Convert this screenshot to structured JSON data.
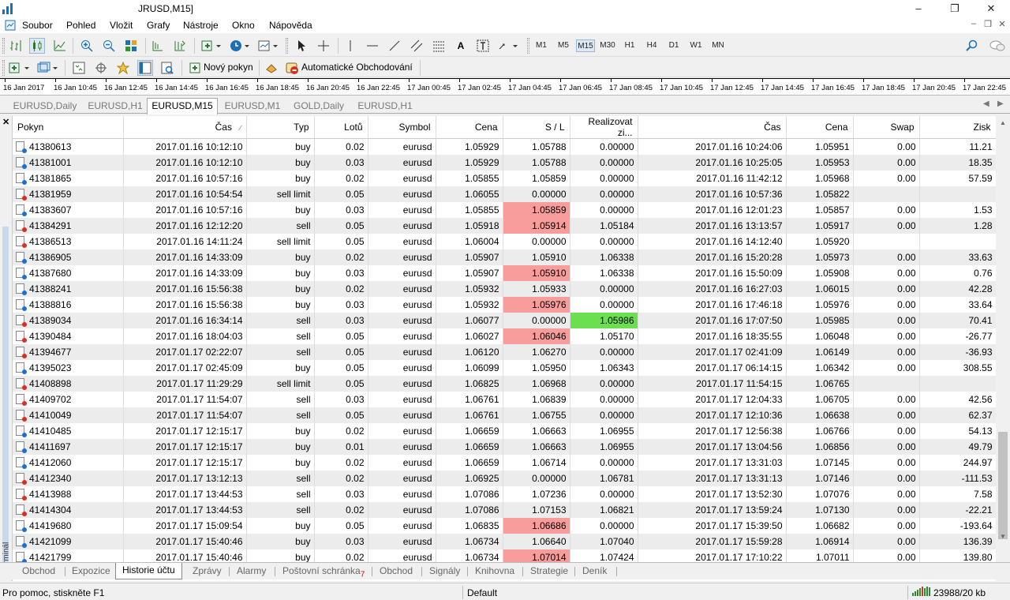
{
  "window": {
    "title": "JRUSD,M15]"
  },
  "menu": [
    "Soubor",
    "Pohled",
    "Vložit",
    "Grafy",
    "Nástroje",
    "Okno",
    "Nápověda"
  ],
  "toolbar": {
    "timeframes": [
      "M1",
      "M5",
      "M15",
      "M30",
      "H1",
      "H4",
      "D1",
      "W1",
      "MN"
    ],
    "active_timeframe": "M15",
    "new_order": "Nový pokyn",
    "auto_trading": "Automatické Obchodování"
  },
  "time_axis": [
    "16 Jan 2017",
    "16 Jan 10:45",
    "16 Jan 12:45",
    "16 Jan 14:45",
    "16 Jan 16:45",
    "16 Jan 18:45",
    "16 Jan 20:45",
    "16 Jan 22:45",
    "17 Jan 00:45",
    "17 Jan 02:45",
    "17 Jan 04:45",
    "17 Jan 06:45",
    "17 Jan 08:45",
    "17 Jan 10:45",
    "17 Jan 12:45",
    "17 Jan 14:45",
    "17 Jan 16:45",
    "17 Jan 18:45",
    "17 Jan 20:45",
    "17 Jan 22:45"
  ],
  "chart_tabs": [
    "EURUSD,Daily",
    "EURUSD,H1",
    "EURUSD,M15",
    "EURUSD,M1",
    "GOLD,Daily",
    "EURUSD,H1"
  ],
  "active_chart_tab": "EURUSD,M15",
  "terminal_label": "Terminál",
  "columns": [
    "Pokyn",
    "Čas",
    "Typ",
    "Lotů",
    "Symbol",
    "Cena",
    "S / L",
    "Realizovat zi...",
    "Čas",
    "Cena",
    "Swap",
    "Zisk"
  ],
  "rows": [
    {
      "id": "41380613",
      "open": "2017.01.16 10:12:10",
      "type": "buy",
      "lots": "0.02",
      "symbol": "eurusd",
      "price": "1.05929",
      "sl": "1.05788",
      "tp": "0.00000",
      "close": "2017.01.16 10:24:06",
      "cprice": "1.05951",
      "swap": "0.00",
      "profit": "11.21"
    },
    {
      "id": "41381001",
      "open": "2017.01.16 10:12:10",
      "type": "buy",
      "lots": "0.03",
      "symbol": "eurusd",
      "price": "1.05929",
      "sl": "1.05788",
      "tp": "0.00000",
      "close": "2017.01.16 10:25:05",
      "cprice": "1.05953",
      "swap": "0.00",
      "profit": "18.35"
    },
    {
      "id": "41381865",
      "open": "2017.01.16 10:57:16",
      "type": "buy",
      "lots": "0.02",
      "symbol": "eurusd",
      "price": "1.05855",
      "sl": "1.05859",
      "tp": "0.00000",
      "close": "2017.01.16 11:42:12",
      "cprice": "1.05968",
      "swap": "0.00",
      "profit": "57.59"
    },
    {
      "id": "41381959",
      "open": "2017.01.16 10:54:54",
      "type": "sell limit",
      "lots": "0.05",
      "symbol": "eurusd",
      "price": "1.06055",
      "sl": "0.00000",
      "tp": "0.00000",
      "close": "2017.01.16 10:57:36",
      "cprice": "1.05822",
      "swap": "",
      "profit": ""
    },
    {
      "id": "41383607",
      "open": "2017.01.16 10:57:16",
      "type": "buy",
      "lots": "0.03",
      "symbol": "eurusd",
      "price": "1.05855",
      "sl": "1.05859",
      "tp": "0.00000",
      "close": "2017.01.16 12:01:23",
      "cprice": "1.05857",
      "swap": "0.00",
      "profit": "1.53",
      "sl_hit": true
    },
    {
      "id": "41384291",
      "open": "2017.01.16 12:12:20",
      "type": "sell",
      "lots": "0.05",
      "symbol": "eurusd",
      "price": "1.05918",
      "sl": "1.05914",
      "tp": "1.05184",
      "close": "2017.01.16 13:13:57",
      "cprice": "1.05917",
      "swap": "0.00",
      "profit": "1.28",
      "sl_hit": true
    },
    {
      "id": "41386513",
      "open": "2017.01.16 14:11:24",
      "type": "sell limit",
      "lots": "0.05",
      "symbol": "eurusd",
      "price": "1.06004",
      "sl": "0.00000",
      "tp": "0.00000",
      "close": "2017.01.16 14:12:40",
      "cprice": "1.05920",
      "swap": "",
      "profit": ""
    },
    {
      "id": "41386905",
      "open": "2017.01.16 14:33:09",
      "type": "buy",
      "lots": "0.02",
      "symbol": "eurusd",
      "price": "1.05907",
      "sl": "1.05910",
      "tp": "1.06338",
      "close": "2017.01.16 15:20:28",
      "cprice": "1.05973",
      "swap": "0.00",
      "profit": "33.63"
    },
    {
      "id": "41387680",
      "open": "2017.01.16 14:33:09",
      "type": "buy",
      "lots": "0.03",
      "symbol": "eurusd",
      "price": "1.05907",
      "sl": "1.05910",
      "tp": "1.06338",
      "close": "2017.01.16 15:50:09",
      "cprice": "1.05908",
      "swap": "0.00",
      "profit": "0.76",
      "sl_hit": true
    },
    {
      "id": "41388241",
      "open": "2017.01.16 15:56:38",
      "type": "buy",
      "lots": "0.02",
      "symbol": "eurusd",
      "price": "1.05932",
      "sl": "1.05933",
      "tp": "0.00000",
      "close": "2017.01.16 16:27:03",
      "cprice": "1.06015",
      "swap": "0.00",
      "profit": "42.28"
    },
    {
      "id": "41388816",
      "open": "2017.01.16 15:56:38",
      "type": "buy",
      "lots": "0.03",
      "symbol": "eurusd",
      "price": "1.05932",
      "sl": "1.05976",
      "tp": "0.00000",
      "close": "2017.01.16 17:46:18",
      "cprice": "1.05976",
      "swap": "0.00",
      "profit": "33.64",
      "sl_hit": true
    },
    {
      "id": "41389034",
      "open": "2017.01.16 16:34:14",
      "type": "sell",
      "lots": "0.03",
      "symbol": "eurusd",
      "price": "1.06077",
      "sl": "0.00000",
      "tp": "1.05986",
      "close": "2017.01.16 17:07:50",
      "cprice": "1.05985",
      "swap": "0.00",
      "profit": "70.41",
      "tp_hit": true
    },
    {
      "id": "41390484",
      "open": "2017.01.16 18:04:03",
      "type": "sell",
      "lots": "0.05",
      "symbol": "eurusd",
      "price": "1.06027",
      "sl": "1.06046",
      "tp": "1.05170",
      "close": "2017.01.16 18:35:55",
      "cprice": "1.06048",
      "swap": "0.00",
      "profit": "-26.77",
      "sl_hit": true
    },
    {
      "id": "41394677",
      "open": "2017.01.17 02:22:07",
      "type": "sell",
      "lots": "0.05",
      "symbol": "eurusd",
      "price": "1.06120",
      "sl": "1.06270",
      "tp": "0.00000",
      "close": "2017.01.17 02:41:09",
      "cprice": "1.06149",
      "swap": "0.00",
      "profit": "-36.93"
    },
    {
      "id": "41395023",
      "open": "2017.01.17 02:45:09",
      "type": "buy",
      "lots": "0.05",
      "symbol": "eurusd",
      "price": "1.06099",
      "sl": "1.05950",
      "tp": "1.06343",
      "close": "2017.01.17 06:14:15",
      "cprice": "1.06342",
      "swap": "0.00",
      "profit": "308.55"
    },
    {
      "id": "41408898",
      "open": "2017.01.17 11:29:29",
      "type": "sell limit",
      "lots": "0.05",
      "symbol": "eurusd",
      "price": "1.06825",
      "sl": "1.06968",
      "tp": "0.00000",
      "close": "2017.01.17 11:54:15",
      "cprice": "1.06765",
      "swap": "",
      "profit": ""
    },
    {
      "id": "41409702",
      "open": "2017.01.17 11:54:07",
      "type": "sell",
      "lots": "0.03",
      "symbol": "eurusd",
      "price": "1.06761",
      "sl": "1.06839",
      "tp": "0.00000",
      "close": "2017.01.17 12:04:33",
      "cprice": "1.06705",
      "swap": "0.00",
      "profit": "42.56"
    },
    {
      "id": "41410049",
      "open": "2017.01.17 11:54:07",
      "type": "sell",
      "lots": "0.05",
      "symbol": "eurusd",
      "price": "1.06761",
      "sl": "1.06755",
      "tp": "0.00000",
      "close": "2017.01.17 12:10:36",
      "cprice": "1.06638",
      "swap": "0.00",
      "profit": "62.37"
    },
    {
      "id": "41410485",
      "open": "2017.01.17 12:15:17",
      "type": "buy",
      "lots": "0.02",
      "symbol": "eurusd",
      "price": "1.06659",
      "sl": "1.06663",
      "tp": "1.06955",
      "close": "2017.01.17 12:56:38",
      "cprice": "1.06766",
      "swap": "0.00",
      "profit": "54.13"
    },
    {
      "id": "41411697",
      "open": "2017.01.17 12:15:17",
      "type": "buy",
      "lots": "0.01",
      "symbol": "eurusd",
      "price": "1.06659",
      "sl": "1.06663",
      "tp": "1.06955",
      "close": "2017.01.17 13:04:56",
      "cprice": "1.06856",
      "swap": "0.00",
      "profit": "49.79"
    },
    {
      "id": "41412060",
      "open": "2017.01.17 12:15:17",
      "type": "buy",
      "lots": "0.02",
      "symbol": "eurusd",
      "price": "1.06659",
      "sl": "1.06714",
      "tp": "0.00000",
      "close": "2017.01.17 13:31:03",
      "cprice": "1.07145",
      "swap": "0.00",
      "profit": "244.97"
    },
    {
      "id": "41412340",
      "open": "2017.01.17 13:12:13",
      "type": "sell",
      "lots": "0.02",
      "symbol": "eurusd",
      "price": "1.06925",
      "sl": "0.00000",
      "tp": "1.06781",
      "close": "2017.01.17 13:31:13",
      "cprice": "1.07146",
      "swap": "0.00",
      "profit": "-111.53"
    },
    {
      "id": "41413988",
      "open": "2017.01.17 13:44:53",
      "type": "sell",
      "lots": "0.03",
      "symbol": "eurusd",
      "price": "1.07086",
      "sl": "1.07236",
      "tp": "0.00000",
      "close": "2017.01.17 13:52:30",
      "cprice": "1.07076",
      "swap": "0.00",
      "profit": "7.58"
    },
    {
      "id": "41414304",
      "open": "2017.01.17 13:44:53",
      "type": "sell",
      "lots": "0.02",
      "symbol": "eurusd",
      "price": "1.07086",
      "sl": "1.07153",
      "tp": "1.06821",
      "close": "2017.01.17 13:59:24",
      "cprice": "1.07130",
      "swap": "0.00",
      "profit": "-22.21"
    },
    {
      "id": "41419680",
      "open": "2017.01.17 15:09:54",
      "type": "buy",
      "lots": "0.05",
      "symbol": "eurusd",
      "price": "1.06835",
      "sl": "1.06686",
      "tp": "0.00000",
      "close": "2017.01.17 15:39:50",
      "cprice": "1.06682",
      "swap": "0.00",
      "profit": "-193.64",
      "sl_hit": true
    },
    {
      "id": "41421099",
      "open": "2017.01.17 15:40:46",
      "type": "buy",
      "lots": "0.03",
      "symbol": "eurusd",
      "price": "1.06734",
      "sl": "1.06640",
      "tp": "1.07040",
      "close": "2017.01.17 15:59:28",
      "cprice": "1.06914",
      "swap": "0.00",
      "profit": "136.39"
    },
    {
      "id": "41421799",
      "open": "2017.01.17 15:40:46",
      "type": "buy",
      "lots": "0.02",
      "symbol": "eurusd",
      "price": "1.06734",
      "sl": "1.07014",
      "tp": "1.07424",
      "close": "2017.01.17 17:10:22",
      "cprice": "1.07011",
      "swap": "0.00",
      "profit": "139.80",
      "sl_hit": true
    }
  ],
  "bottom_tabs": [
    "Obchod",
    "Expozice",
    "Historie účtu",
    "Zprávy",
    "Alarmy",
    "Poštovní schránka",
    "Obchod",
    "Signály",
    "Knihovna",
    "Strategie",
    "Deník"
  ],
  "active_bottom_tab": "Historie účtu",
  "mailbox_badge": "7",
  "status": {
    "help": "Pro pomoc, stiskněte F1",
    "profile": "Default",
    "traffic": "23988/20 kb"
  },
  "colors": {
    "sl_hit": "#f89c9c",
    "tp_hit": "#6adf50"
  }
}
